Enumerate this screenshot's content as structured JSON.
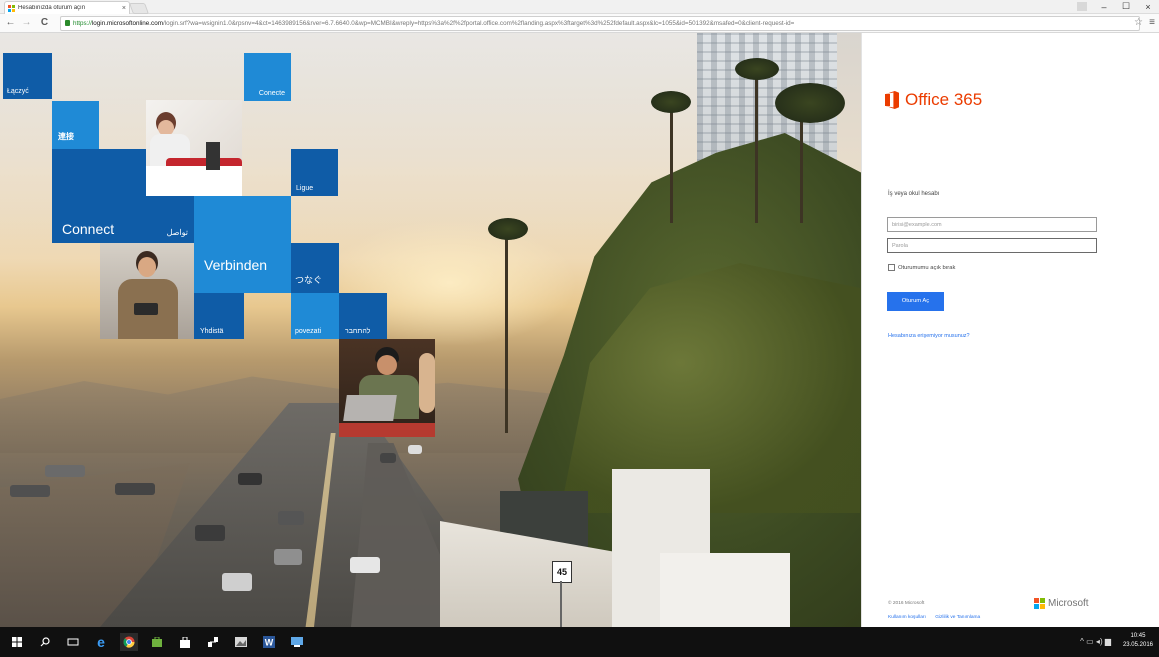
{
  "browser": {
    "tab_title": "Hesabınızda oturum açın",
    "tab_close": "×",
    "url_scheme": "https://",
    "url_host": "login.microsoftonline.com",
    "url_rest": "/login.srf?wa=wsignin1.0&rpsnv=4&ct=1463989156&rver=6.7.6640.0&wp=MCMBI&wreply=https%3a%2f%2fportal.office.com%2flanding.aspx%3ftarget%3d%252fdefault.aspx&lc=1055&id=501392&msafed=0&client-request-id=",
    "back": "←",
    "forward": "→",
    "reload": "C",
    "star": "☆",
    "menu": "≡",
    "minimize": "–",
    "maximize": "☐",
    "close": "×"
  },
  "tiles": {
    "laczyc": "Łączyć",
    "conecte": "Conecte",
    "chinese": "連接",
    "ligue": "Ligue",
    "connect": "Connect",
    "arabic": "تواصل",
    "verbinden": "Verbinden",
    "japanese": "つなぐ",
    "yhdista": "Yhdistä",
    "povezati": "povezati",
    "hebrew": "להתחבר"
  },
  "login": {
    "brand": "Office 365",
    "account_label": "İş veya okul hesabı",
    "email_placeholder": "birisi@example.com",
    "password_placeholder": "Parola",
    "keep_signed_in": "Oturumumu açık bırak",
    "sign_in": "Oturum Aç",
    "forgot": "Hesabınıza erişemiyor musunuz?",
    "copyright": "© 2016 Microsoft",
    "terms": "Kullanım koşulları",
    "privacy": "Gizlilik ve Tanımlama",
    "microsoft": "Microsoft"
  },
  "taskbar": {
    "time": "10:45",
    "date": "23.05.2016"
  },
  "colors": {
    "tile_blue": "#0f5ca7",
    "tile_light": "#1f8ad6",
    "office_orange": "#eb3c00",
    "signin_blue": "#2672ec"
  }
}
